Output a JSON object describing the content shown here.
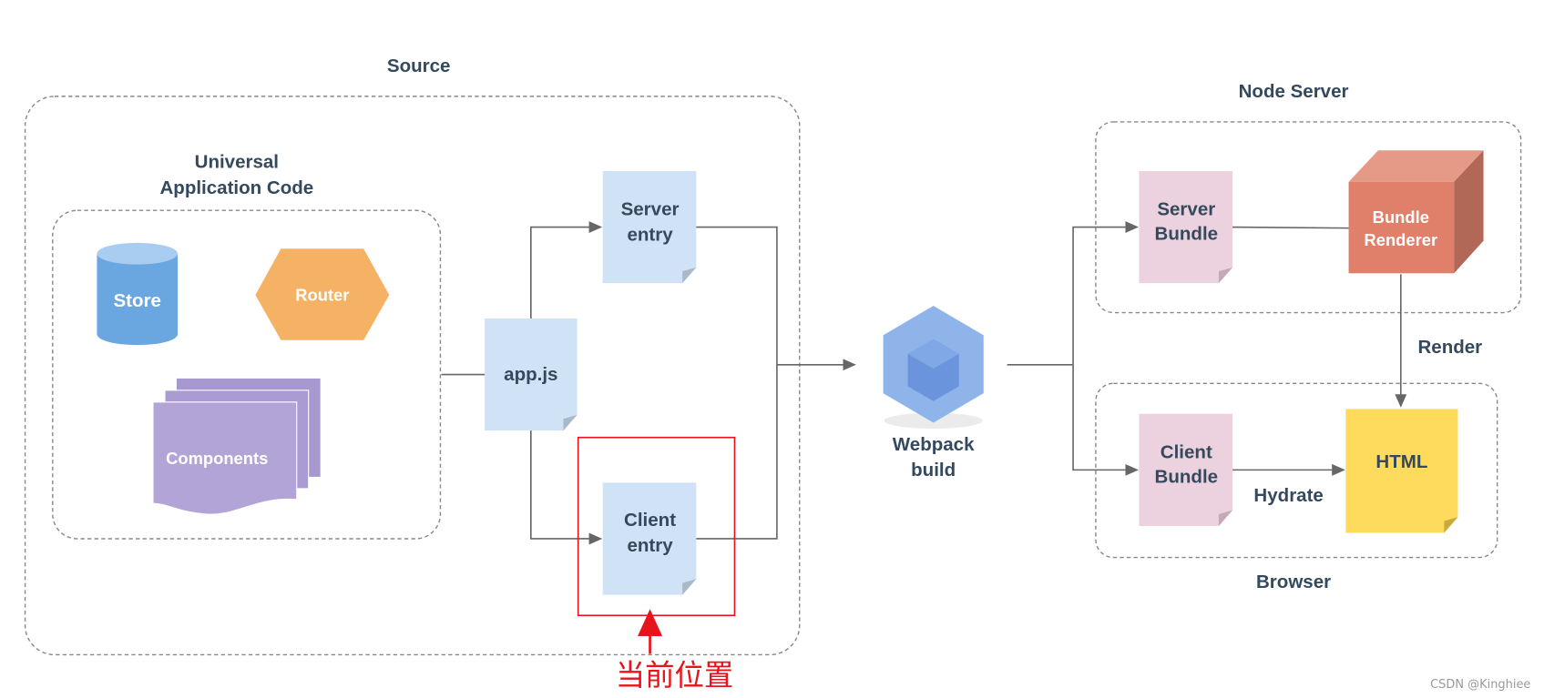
{
  "groups": {
    "source": "Source",
    "universal_line1": "Universal",
    "universal_line2": "Application Code",
    "node_server": "Node Server",
    "browser": "Browser"
  },
  "nodes": {
    "store": "Store",
    "router": "Router",
    "components": "Components",
    "app_js": "app.js",
    "server_entry": [
      "Server",
      "entry"
    ],
    "client_entry": [
      "Client",
      "entry"
    ],
    "webpack": [
      "Webpack",
      "build"
    ],
    "server_bundle": [
      "Server",
      "Bundle"
    ],
    "bundle_renderer": [
      "Bundle",
      "Renderer"
    ],
    "client_bundle": [
      "Client",
      "Bundle"
    ],
    "html": "HTML"
  },
  "edge_labels": {
    "render": "Render",
    "hydrate": "Hydrate"
  },
  "annotation": {
    "text": "当前位置",
    "color": "#e8141b"
  },
  "watermark": "CSDN @Kinghiee",
  "colors": {
    "doc_blue": "#cfe2f6",
    "doc_pink": "#ecd1de",
    "store": "#6aa7e0",
    "router": "#f6b264",
    "components": "#b3a4d7",
    "renderer": "#e0806b",
    "html": "#fedb5d",
    "text": "#34495e"
  }
}
